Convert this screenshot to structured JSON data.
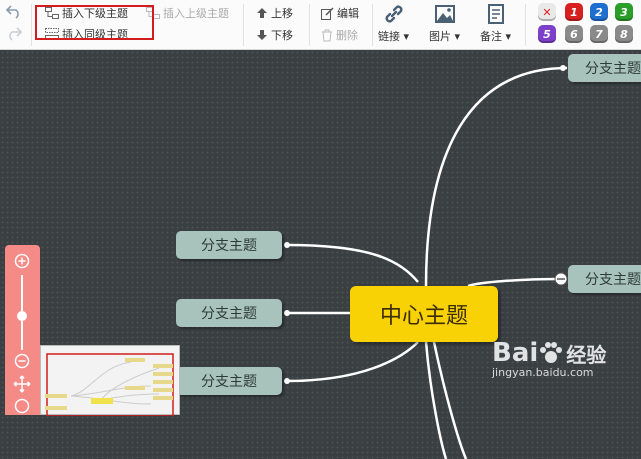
{
  "toolbar": {
    "insert_child": "插入下级主题",
    "insert_parent": "插入上级主题",
    "insert_sibling": "插入同级主题",
    "move_up": "上移",
    "move_down": "下移",
    "edit": "编辑",
    "delete": "删除",
    "link": "链接",
    "image": "图片",
    "note": "备注",
    "priorities": [
      {
        "label": "✕",
        "color": "#e9e9e9",
        "text": "#d22"
      },
      {
        "label": "1",
        "color": "#d92020",
        "text": "#fff"
      },
      {
        "label": "2",
        "color": "#1f6fd1",
        "text": "#fff"
      },
      {
        "label": "3",
        "color": "#2a9d2a",
        "text": "#fff"
      },
      {
        "label": "5",
        "color": "#7d3fc8",
        "text": "#fff"
      },
      {
        "label": "6",
        "color": "#8a8a8a",
        "text": "#fff"
      },
      {
        "label": "7",
        "color": "#8a8a8a",
        "text": "#fff"
      },
      {
        "label": "8",
        "color": "#8a8a8a",
        "text": "#fff"
      }
    ]
  },
  "mindmap": {
    "center_topic": "中心主题",
    "branch_topics": [
      "分支主题",
      "分支主题",
      "分支主题",
      "分支主题",
      "分支主题"
    ]
  },
  "watermark": {
    "brand": "Bai",
    "brand_suffix": "经验",
    "url": "jingyan.baidu.com"
  },
  "colors": {
    "canvas": "#3a3f42",
    "branch_node": "#a8c2bc",
    "center_node": "#f8d205",
    "zoom_bar": "#f48b87",
    "highlight_box": "#d31d1d"
  }
}
